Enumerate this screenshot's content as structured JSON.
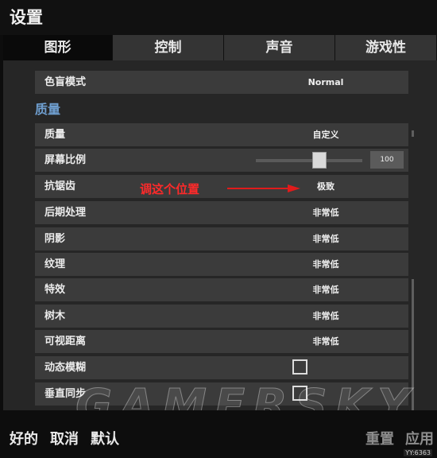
{
  "window": {
    "title": "设置"
  },
  "tabs": [
    {
      "label": "图形",
      "active": true
    },
    {
      "label": "控制",
      "active": false
    },
    {
      "label": "声音",
      "active": false
    },
    {
      "label": "游戏性",
      "active": false
    }
  ],
  "settings": {
    "colorblind": {
      "label": "色盲模式",
      "value": "Normal"
    },
    "section_title": "质量",
    "rows": [
      {
        "label": "质量",
        "value": "自定义"
      },
      {
        "label": "屏幕比例",
        "value": "100"
      },
      {
        "label": "抗锯齿",
        "value": "极致"
      },
      {
        "label": "后期处理",
        "value": "非常低"
      },
      {
        "label": "阴影",
        "value": "非常低"
      },
      {
        "label": "纹理",
        "value": "非常低"
      },
      {
        "label": "特效",
        "value": "非常低"
      },
      {
        "label": "树木",
        "value": "非常低"
      },
      {
        "label": "可视距离",
        "value": "非常低"
      },
      {
        "label": "动态模糊",
        "checked": false
      },
      {
        "label": "垂直同步",
        "checked": false
      }
    ]
  },
  "annotation": {
    "text": "调这个位置",
    "color": "#ff2a2a"
  },
  "watermark": "GAMERSKY",
  "footer": {
    "ok": "好的",
    "cancel": "取消",
    "default": "默认",
    "reset": "重置",
    "apply": "应用",
    "credit": "YY:6363"
  },
  "colors": {
    "section_title": "#6f9fd0",
    "row_bg": "#3b3b3b",
    "panel_bg": "#262626"
  },
  "icons": {
    "arrow": "right-arrow-icon",
    "checkbox": "checkbox-empty-icon"
  }
}
